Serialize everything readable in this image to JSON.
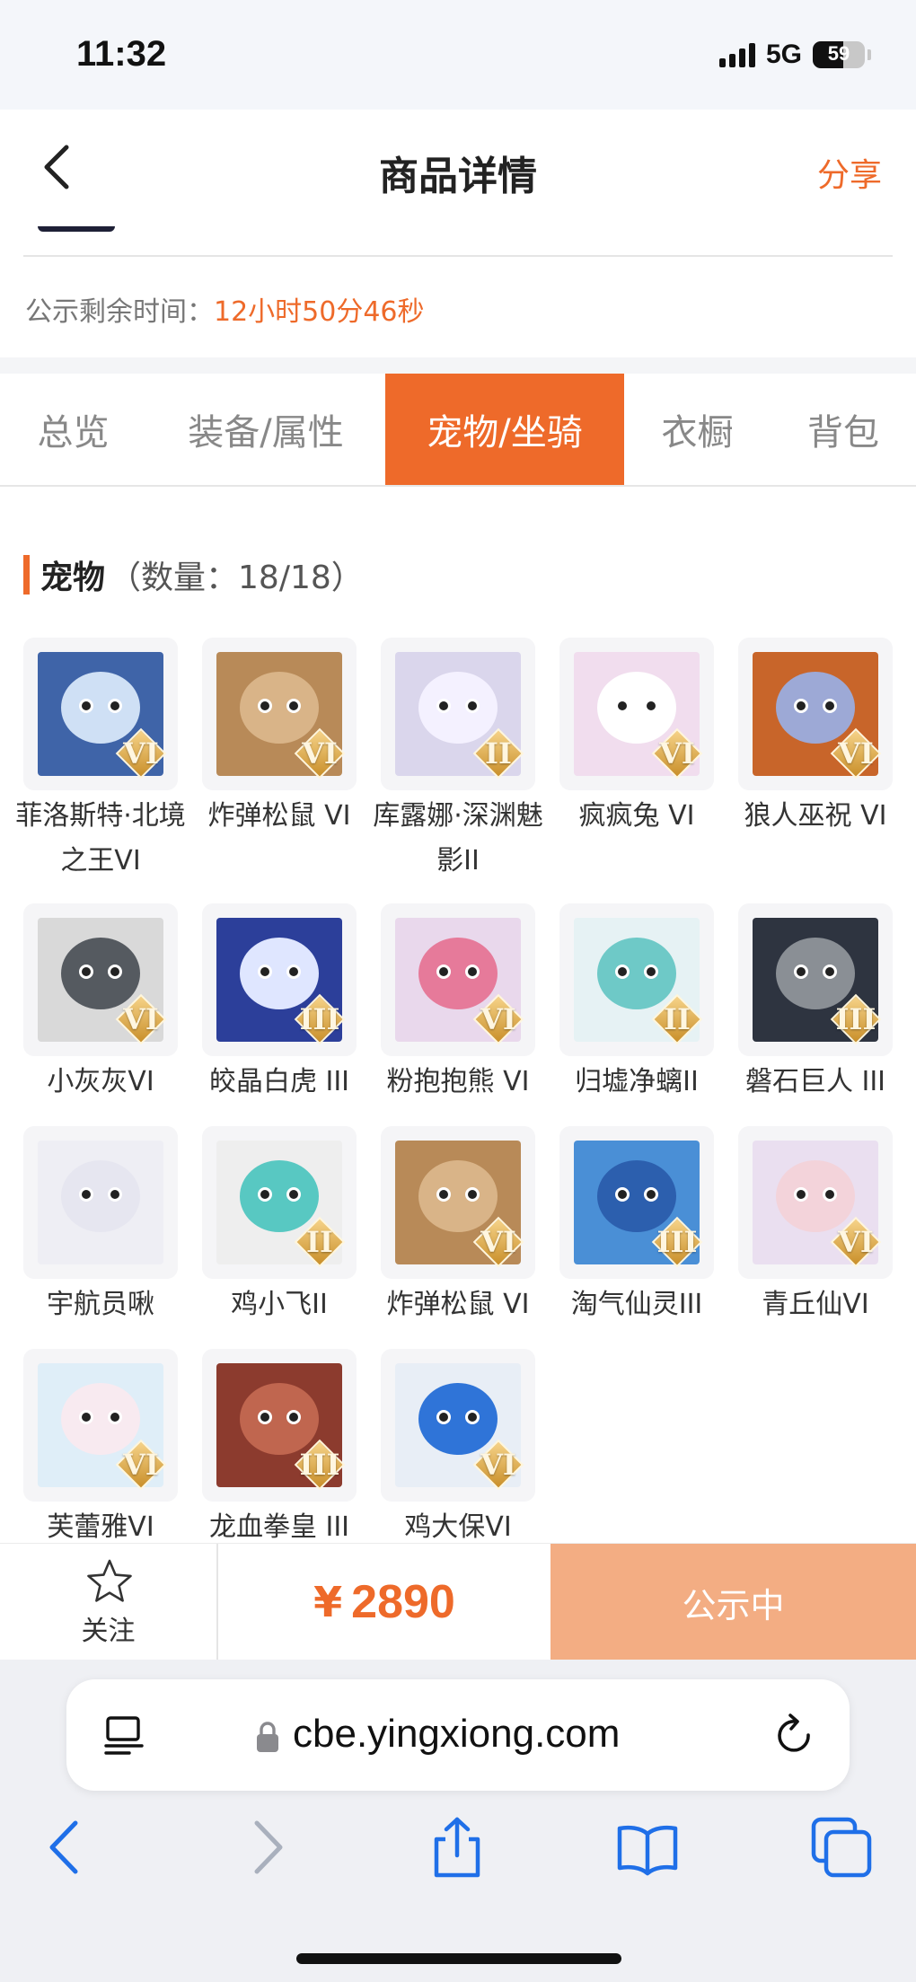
{
  "status_bar": {
    "time": "11:32",
    "network": "5G",
    "battery": "59",
    "battery_fraction": 0.59
  },
  "header": {
    "title": "商品详情",
    "share_label": "分享"
  },
  "notice": {
    "label": "公示剩余时间：",
    "value": "12小时50分46秒"
  },
  "tabs": [
    {
      "label": "总览",
      "active": false
    },
    {
      "label": "装备/属性",
      "active": false
    },
    {
      "label": "宠物/坐骑",
      "active": true
    },
    {
      "label": "衣橱",
      "active": false
    },
    {
      "label": "背包",
      "active": false
    }
  ],
  "pets_section": {
    "title": "宠物",
    "count_text": "（数量：18/18）"
  },
  "pets": [
    {
      "name": "菲洛斯特·北境之王VI",
      "rank": "VI",
      "bg": "#3f64a8",
      "fg": "#cfe0f5"
    },
    {
      "name": "炸弹松鼠 VI",
      "rank": "VI",
      "bg": "#b88a58",
      "fg": "#d9b488"
    },
    {
      "name": "库露娜·深渊魅影II",
      "rank": "II",
      "bg": "#dad6ec",
      "fg": "#f4f1ff"
    },
    {
      "name": "疯疯兔 VI",
      "rank": "VI",
      "bg": "#f1ddee",
      "fg": "#ffffff"
    },
    {
      "name": "狼人巫祝 VI",
      "rank": "VI",
      "bg": "#c8652a",
      "fg": "#9da9d6"
    },
    {
      "name": "小灰灰VI",
      "rank": "VI",
      "bg": "#d9d9d9",
      "fg": "#555a60"
    },
    {
      "name": "皎晶白虎 III",
      "rank": "III",
      "bg": "#2c3f9a",
      "fg": "#dfe6ff"
    },
    {
      "name": "粉抱抱熊 VI",
      "rank": "VI",
      "bg": "#e9d8ec",
      "fg": "#e67a9a"
    },
    {
      "name": "归墟净螭II",
      "rank": "II",
      "bg": "#e6f2f4",
      "fg": "#6ec9c7"
    },
    {
      "name": "磐石巨人 III",
      "rank": "III",
      "bg": "#2e3440",
      "fg": "#8a8f95"
    },
    {
      "name": "宇航员啾",
      "rank": "",
      "bg": "#eeeef4",
      "fg": "#e6e6f0"
    },
    {
      "name": "鸡小飞II",
      "rank": "II",
      "bg": "#eeeeee",
      "fg": "#58c8c2"
    },
    {
      "name": "炸弹松鼠 VI",
      "rank": "VI",
      "bg": "#b88a58",
      "fg": "#d9b488"
    },
    {
      "name": "淘气仙灵III",
      "rank": "III",
      "bg": "#4a8fd6",
      "fg": "#2c5fae"
    },
    {
      "name": "青丘仙VI",
      "rank": "VI",
      "bg": "#eadff0",
      "fg": "#f3d3da"
    },
    {
      "name": "芙蕾雅VI",
      "rank": "VI",
      "bg": "#dfeef8",
      "fg": "#f8eaf0"
    },
    {
      "name": "龙血拳皇 III",
      "rank": "III",
      "bg": "#8c3b2e",
      "fg": "#c0664f"
    },
    {
      "name": "鸡大保VI",
      "rank": "VI",
      "bg": "#e8eef6",
      "fg": "#2f74d8"
    }
  ],
  "action_bar": {
    "follow_label": "关注",
    "currency": "¥",
    "price": "2890",
    "status_label": "公示中"
  },
  "browser": {
    "url": "cbe.yingxiong.com"
  },
  "colors": {
    "accent": "#ee6a2a",
    "accent_light": "#f3ad83",
    "ios_blue": "#1f6fe8"
  }
}
